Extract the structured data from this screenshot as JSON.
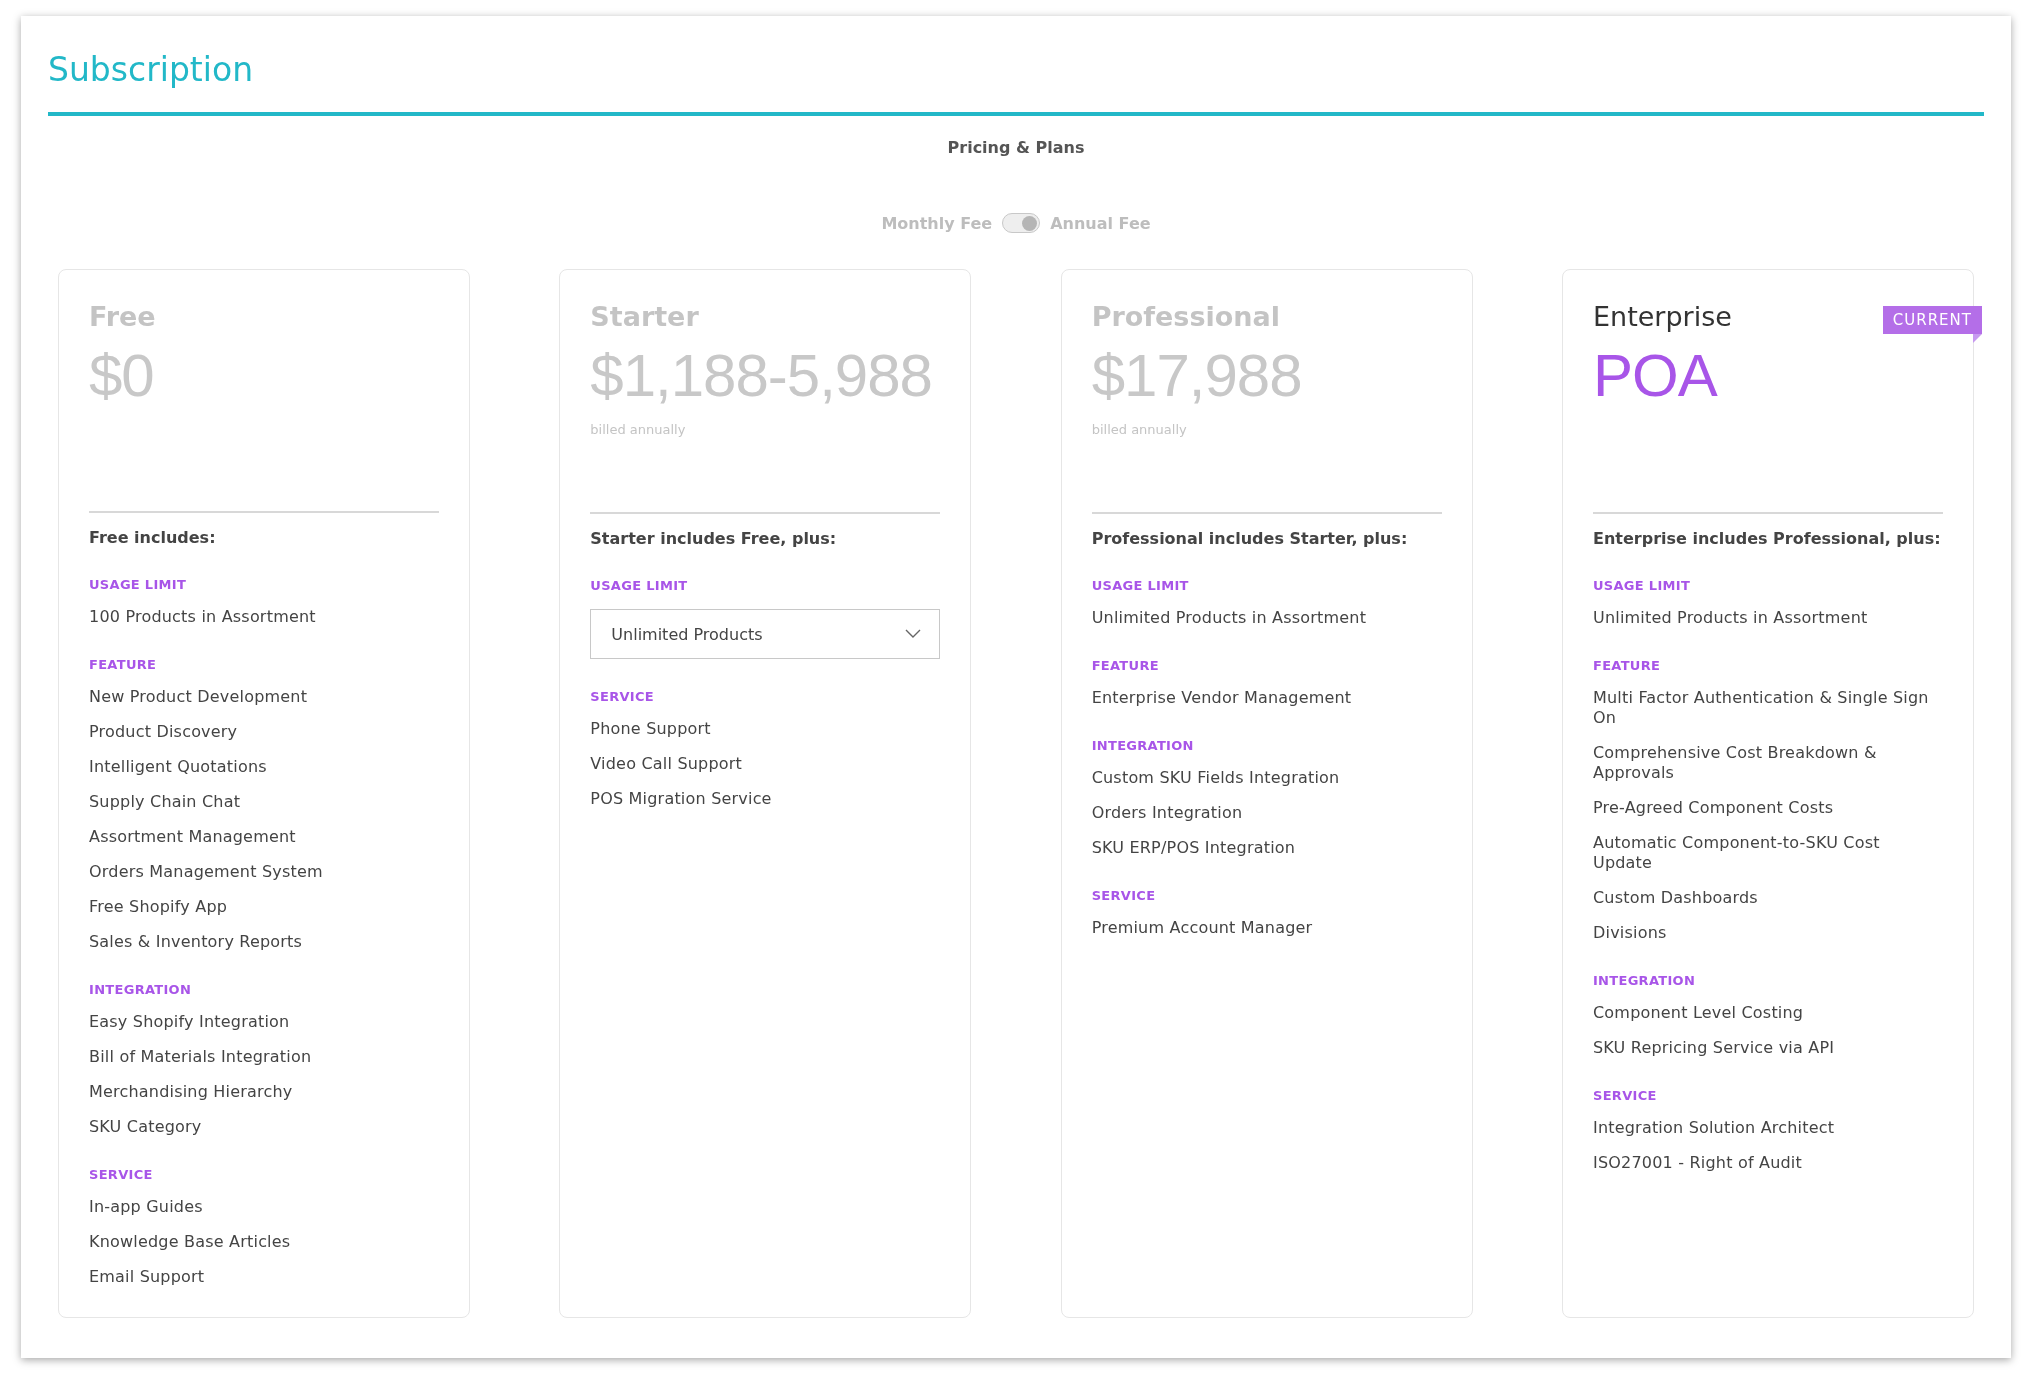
{
  "title": "Subscription",
  "subtitle": "Pricing & Plans",
  "billing_toggle": {
    "left_label": "Monthly Fee",
    "right_label": "Annual Fee",
    "on": true
  },
  "plans": [
    {
      "name": "Free",
      "price": "$0",
      "current": false,
      "includes": "Free includes:",
      "sections": [
        {
          "label": "USAGE LIMIT",
          "items": [
            {
              "kind": "text",
              "text": "100 Products in Assortment"
            }
          ]
        },
        {
          "label": "FEATURE",
          "items": [
            {
              "kind": "text",
              "text": "New Product Development"
            },
            {
              "kind": "text",
              "text": "Product Discovery"
            },
            {
              "kind": "text",
              "text": "Intelligent Quotations"
            },
            {
              "kind": "text",
              "text": "Supply Chain Chat"
            },
            {
              "kind": "text",
              "text": "Assortment Management"
            },
            {
              "kind": "text",
              "text": "Orders Management System"
            },
            {
              "kind": "text",
              "text": "Free Shopify App"
            },
            {
              "kind": "text",
              "text": "Sales & Inventory Reports"
            }
          ]
        },
        {
          "label": "INTEGRATION",
          "items": [
            {
              "kind": "text",
              "text": "Easy Shopify Integration"
            },
            {
              "kind": "text",
              "text": "Bill of Materials Integration"
            },
            {
              "kind": "text",
              "text": "Merchandising Hierarchy"
            },
            {
              "kind": "text",
              "text": "SKU Category"
            }
          ]
        },
        {
          "label": "SERVICE",
          "items": [
            {
              "kind": "text",
              "text": "In-app Guides"
            },
            {
              "kind": "text",
              "text": "Knowledge Base Articles"
            },
            {
              "kind": "text",
              "text": "Email Support"
            }
          ]
        }
      ]
    },
    {
      "name": "Starter",
      "price": "$1,188-5,988",
      "billing_note": "billed annually",
      "current": false,
      "includes": "Starter includes Free, plus:",
      "sections": [
        {
          "label": "USAGE LIMIT",
          "items": [
            {
              "kind": "dropdown",
              "text": "Unlimited Products"
            }
          ]
        },
        {
          "label": "SERVICE",
          "items": [
            {
              "kind": "text",
              "text": "Phone Support"
            },
            {
              "kind": "text",
              "text": "Video Call Support"
            },
            {
              "kind": "text",
              "text": "POS Migration Service"
            }
          ]
        }
      ]
    },
    {
      "name": "Professional",
      "price": "$17,988",
      "billing_note": "billed annually",
      "current": false,
      "includes": "Professional includes Starter, plus:",
      "sections": [
        {
          "label": "USAGE LIMIT",
          "items": [
            {
              "kind": "text",
              "text": "Unlimited Products in Assortment"
            }
          ]
        },
        {
          "label": "FEATURE",
          "items": [
            {
              "kind": "text",
              "text": "Enterprise Vendor Management"
            }
          ]
        },
        {
          "label": "INTEGRATION",
          "items": [
            {
              "kind": "text",
              "text": "Custom SKU Fields Integration"
            },
            {
              "kind": "text",
              "text": "Orders Integration"
            },
            {
              "kind": "text",
              "text": "SKU ERP/POS Integration"
            }
          ]
        },
        {
          "label": "SERVICE",
          "items": [
            {
              "kind": "text",
              "text": "Premium Account Manager"
            }
          ]
        }
      ]
    },
    {
      "name": "Enterprise",
      "price": "POA",
      "current": true,
      "badge": "CURRENT",
      "includes": "Enterprise includes Professional, plus:",
      "sections": [
        {
          "label": "USAGE LIMIT",
          "items": [
            {
              "kind": "text",
              "text": "Unlimited Products in Assortment"
            }
          ]
        },
        {
          "label": "FEATURE",
          "items": [
            {
              "kind": "text",
              "text": "Multi Factor Authentication & Single Sign On"
            },
            {
              "kind": "text",
              "text": "Comprehensive Cost Breakdown & Approvals"
            },
            {
              "kind": "text",
              "text": "Pre-Agreed Component Costs"
            },
            {
              "kind": "text",
              "text": "Automatic Component-to-SKU Cost Update"
            },
            {
              "kind": "text",
              "text": "Custom Dashboards"
            },
            {
              "kind": "text",
              "text": "Divisions"
            }
          ]
        },
        {
          "label": "INTEGRATION",
          "items": [
            {
              "kind": "text",
              "text": "Component Level Costing"
            },
            {
              "kind": "text",
              "text": "SKU Repricing Service via API"
            }
          ]
        },
        {
          "label": "SERVICE",
          "items": [
            {
              "kind": "text",
              "text": "Integration Solution Architect"
            },
            {
              "kind": "text",
              "text": "ISO27001 - Right of Audit"
            }
          ]
        }
      ]
    }
  ]
}
